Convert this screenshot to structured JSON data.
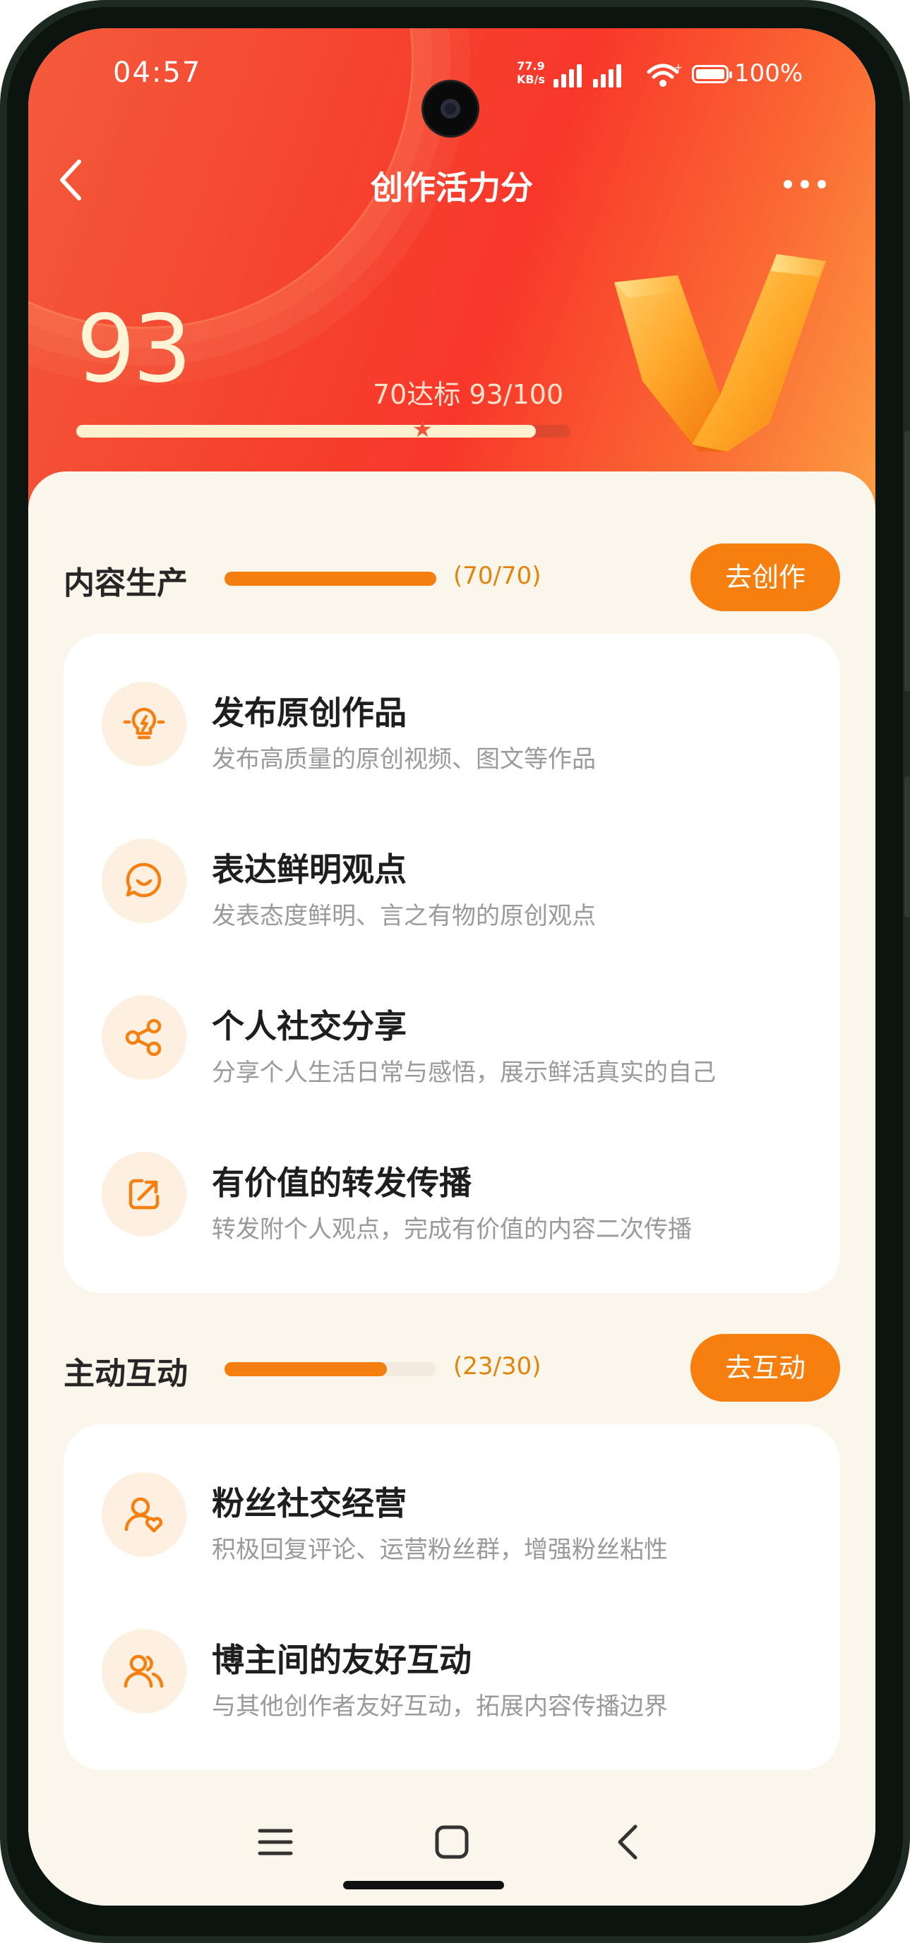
{
  "status_bar": {
    "time": "04:57",
    "net_speed_value": "77.9",
    "net_speed_unit": "KB/s",
    "battery": "100%"
  },
  "header": {
    "title": "创作活力分",
    "back_icon": "chevron-left-icon",
    "more_icon": "more-horizontal-icon"
  },
  "score": {
    "value": "93",
    "target_text": "70达标 93/100",
    "progress_fraction": 0.93,
    "target_fraction": 0.7
  },
  "sections": [
    {
      "title": "内容生产",
      "count": "(70/70)",
      "progress_fraction": 1.0,
      "button": "去创作",
      "items": [
        {
          "title": "发布原创作品",
          "desc": "发布高质量的原创视频、图文等作品",
          "icon": "lightbulb-icon"
        },
        {
          "title": "表达鲜明观点",
          "desc": "发表态度鲜明、言之有物的原创观点",
          "icon": "chat-smile-icon"
        },
        {
          "title": "个人社交分享",
          "desc": "分享个人生活日常与感悟，展示鲜活真实的自己",
          "icon": "share-icon"
        },
        {
          "title": "有价值的转发传播",
          "desc": "转发附个人观点，完成有价值的内容二次传播",
          "icon": "forward-icon"
        }
      ]
    },
    {
      "title": "主动互动",
      "count": "(23/30)",
      "progress_fraction": 0.767,
      "button": "去互动",
      "items": [
        {
          "title": "粉丝社交经营",
          "desc": "积极回复评论、运营粉丝群，增强粉丝粘性",
          "icon": "user-heart-icon"
        },
        {
          "title": "博主间的友好互动",
          "desc": "与其他创作者友好互动，拓展内容传播边界",
          "icon": "users-icon"
        }
      ]
    }
  ],
  "colors": {
    "accent": "#f67f0f",
    "hero_red": "#f5432f",
    "background": "#fbf6ec"
  },
  "navbar": {
    "menu_icon": "menu-icon",
    "home_icon": "home-square-icon",
    "back_icon": "back-triangle-icon"
  }
}
